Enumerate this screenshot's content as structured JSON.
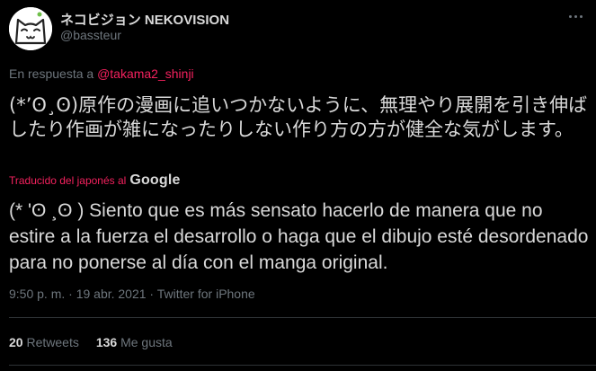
{
  "author": {
    "display_name": "ネコビジョン NEKOVISION",
    "handle": "@bassteur",
    "avatar_icon": "cat-face-avatar"
  },
  "reply": {
    "prefix": "En respuesta a",
    "mention": "@takama2_shinji"
  },
  "tweet": {
    "original_text": "(*’ʘ¸ʘ)原作の漫画に追いつかないように、無理やり展開を引き伸ばしたり作画が雑になったりしない作り方の方が健全な気がします。",
    "translated_label": "Traducido del japonés al",
    "translator_name": "Google",
    "translated_text": "(* 'ʘ ¸ʘ ) Siento que es más sensato hacerlo de manera que no estire a la fuerza el desarrollo o haga que el dibujo esté desordenado para no ponerse al día con el manga original."
  },
  "meta": {
    "timestamp": "9:50 p. m. · 19 abr. 2021 · Twitter for iPhone"
  },
  "stats": {
    "retweets_count": "20",
    "retweets_label": "Retweets",
    "likes_count": "136",
    "likes_label": "Me gusta"
  },
  "colors": {
    "background": "#000000",
    "text": "#d9d9d9",
    "muted": "#6e767d",
    "accent": "#f4215e",
    "divider": "#2f3336"
  }
}
